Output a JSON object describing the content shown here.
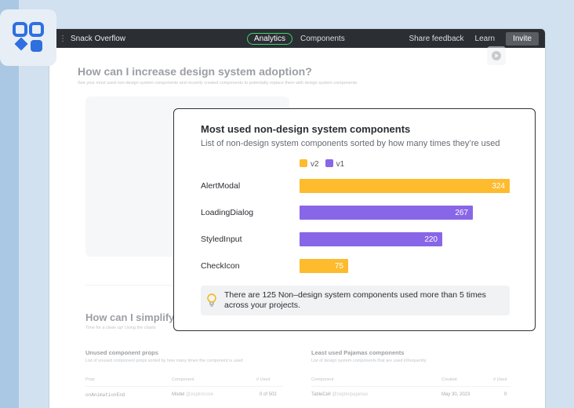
{
  "app": {
    "name": "Snack Overflow"
  },
  "topbar": {
    "tabs": [
      {
        "label": "Analytics",
        "active": true
      },
      {
        "label": "Components",
        "active": false
      }
    ],
    "share_feedback": "Share feedback",
    "learn": "Learn",
    "invite": "Invite"
  },
  "page": {
    "title": "How can I increase design system adoption?",
    "subtitle": "See your most used non-design system components and recently created components to potentially replace them with design system components.",
    "section2_title": "How can I simplify th",
    "section2_subtitle": "Time for a clean up! Using the charts"
  },
  "unused_props": {
    "title": "Unused component props",
    "subtitle": "List of unused component props sorted by how many times the component is used",
    "columns": [
      "Prop",
      "Component",
      "# Used"
    ],
    "rows": [
      {
        "prop": "onAnimationEnd",
        "component": "Model",
        "source": "@zeplin/core",
        "used": "0 of 502"
      }
    ]
  },
  "least_used": {
    "title": "Least used Pajamas components",
    "subtitle": "List of design system components that are used infrequently",
    "columns": [
      "Component",
      "Created",
      "# Used"
    ],
    "rows": [
      {
        "component": "TableCell",
        "source": "@zeplin/pajamas",
        "created": "May 30, 2023",
        "used": "0"
      }
    ]
  },
  "modal": {
    "title": "Most used non-design system components",
    "subtitle": "List of non-design system components sorted by how many times they’re used",
    "tip": "There are 125 Non–design system components used more than 5 times across your projects."
  },
  "colors": {
    "v2": "#fdbb2e",
    "v1": "#8866e8",
    "accent": "#3bd66f"
  },
  "chart_data": {
    "type": "bar",
    "orientation": "horizontal",
    "title": "Most used non-design system components",
    "categories": [
      "AlertModal",
      "LoadingDialog",
      "StyledInput",
      "CheckIcon"
    ],
    "values": [
      324,
      267,
      220,
      75
    ],
    "versions": [
      "v2",
      "v1",
      "v1",
      "v2"
    ],
    "legend": [
      {
        "name": "v2",
        "color": "#fdbb2e"
      },
      {
        "name": "v1",
        "color": "#8866e8"
      }
    ],
    "xlim": [
      0,
      324
    ]
  }
}
